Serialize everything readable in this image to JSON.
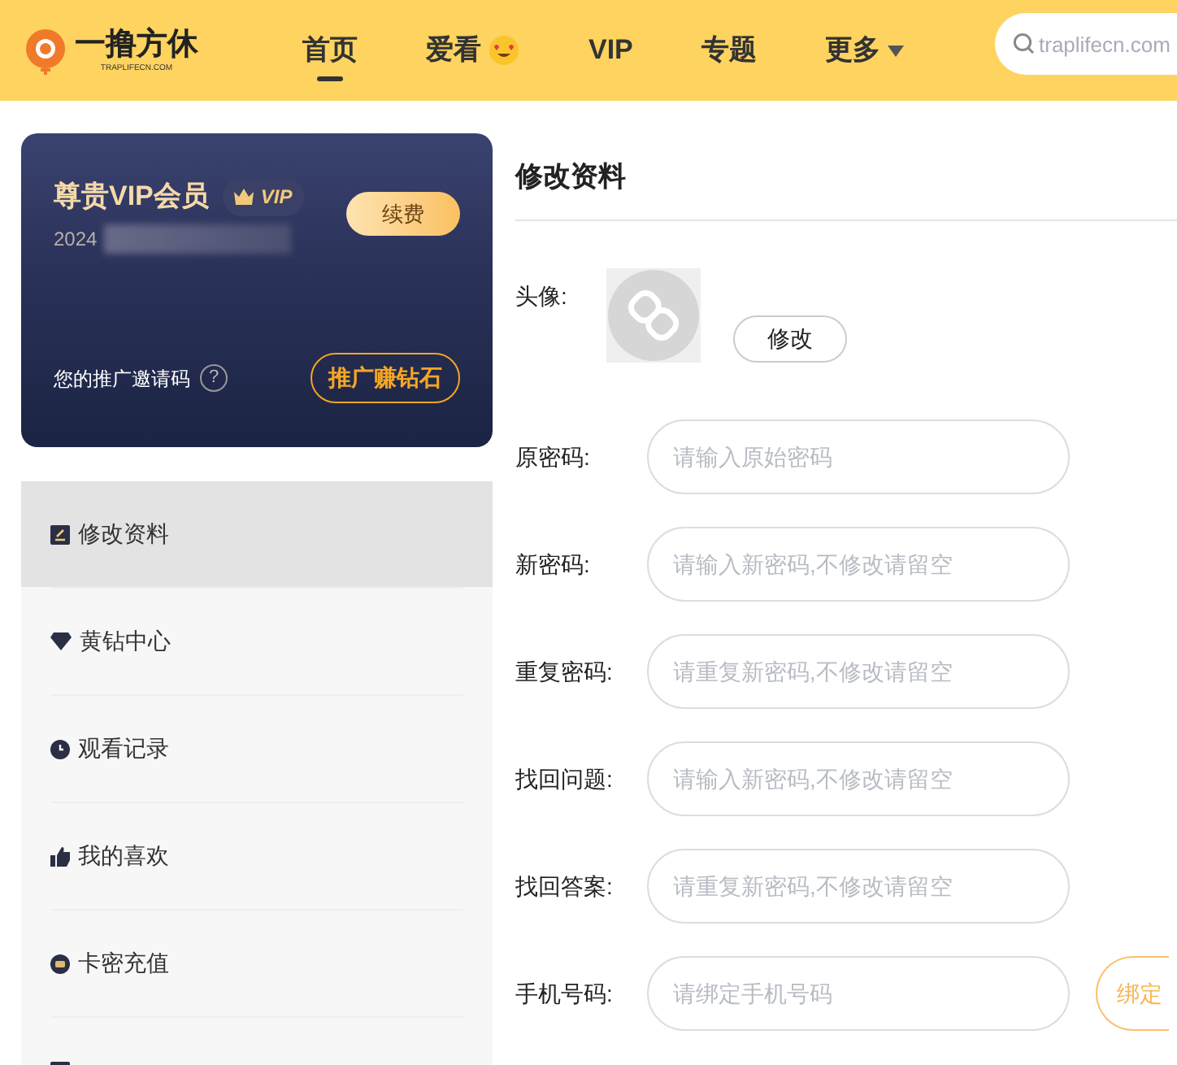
{
  "header": {
    "logo_text": "一撸方休",
    "logo_subtext": "TRAPLIFECN.COM",
    "nav": [
      {
        "label": "首页",
        "selected": true,
        "kind": "plain"
      },
      {
        "label": "爱看",
        "selected": false,
        "kind": "emoji"
      },
      {
        "label": "VIP",
        "selected": false,
        "kind": "plain"
      },
      {
        "label": "专题",
        "selected": false,
        "kind": "plain"
      },
      {
        "label": "更多",
        "selected": false,
        "kind": "dropdown"
      }
    ],
    "search": {
      "placeholder": "traplifecn.com"
    }
  },
  "vip_card": {
    "title": "尊贵VIP会员",
    "badge": "VIP",
    "date": "2024",
    "renew_button": "续费",
    "invite_label": "您的推广邀请码",
    "help": "?",
    "promo_button": "推广赚钻石"
  },
  "sidebar": {
    "items": [
      {
        "label": "修改资料",
        "kind": "edit",
        "selected": true
      },
      {
        "label": "黄钻中心",
        "kind": "diamond",
        "selected": false
      },
      {
        "label": "观看记录",
        "kind": "clock",
        "selected": false
      },
      {
        "label": "我的喜欢",
        "kind": "thumb",
        "selected": false
      },
      {
        "label": "卡密充值",
        "kind": "card",
        "selected": false
      },
      {
        "kind": "chat",
        "selected": false
      }
    ]
  },
  "main": {
    "title": "修改资料",
    "avatar_label": "头像:",
    "avatar_button": "修改",
    "fields": [
      {
        "label": "原密码:",
        "placeholder": "请输入原始密码"
      },
      {
        "label": "新密码:",
        "placeholder": "请输入新密码,不修改请留空"
      },
      {
        "label": "重复密码:",
        "placeholder": "请重复新密码,不修改请留空"
      },
      {
        "label": "找回问题:",
        "placeholder": "请输入新密码,不修改请留空"
      },
      {
        "label": "找回答案:",
        "placeholder": "请重复新密码,不修改请留空"
      },
      {
        "label": "手机号码:",
        "placeholder": "请绑定手机号码",
        "button": "绑定"
      }
    ]
  }
}
